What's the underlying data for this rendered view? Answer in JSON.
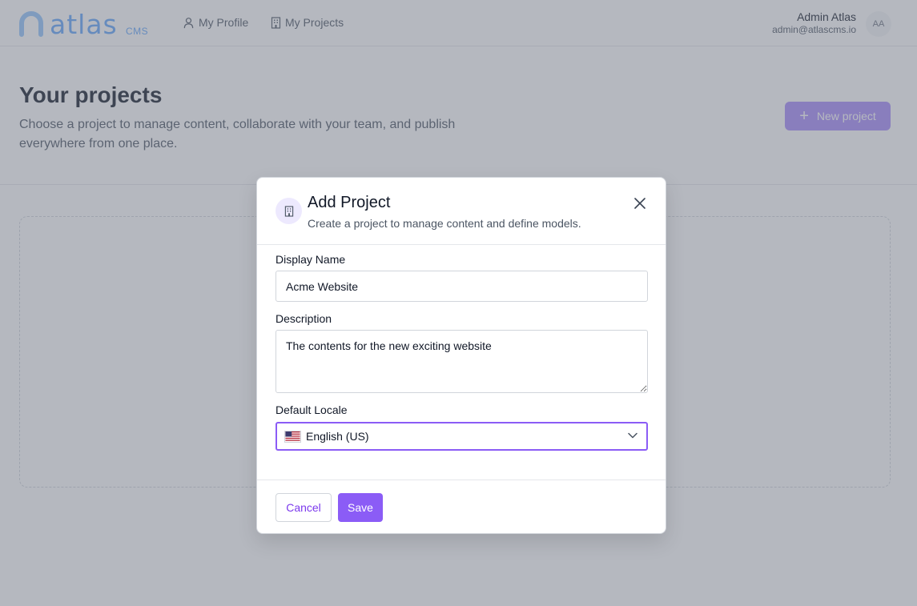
{
  "header": {
    "logo_text": "atlas",
    "logo_sub": "CMS",
    "nav": [
      {
        "label": "My Profile",
        "icon": "user-icon"
      },
      {
        "label": "My Projects",
        "icon": "building-icon"
      }
    ],
    "user": {
      "name": "Admin Atlas",
      "email": "admin@atlascms.io",
      "initials": "AA"
    }
  },
  "page": {
    "title": "Your projects",
    "description": "Choose a project to manage content, collaborate with your team, and publish everywhere from one place.",
    "new_project_label": "New project"
  },
  "modal": {
    "title": "Add Project",
    "subtitle": "Create a project to manage content and define models.",
    "fields": {
      "display_name": {
        "label": "Display Name",
        "value": "Acme Website"
      },
      "description": {
        "label": "Description",
        "value": "The contents for the new exciting website"
      },
      "default_locale": {
        "label": "Default Locale",
        "value": "English (US)",
        "flag": "us-flag-icon"
      }
    },
    "cancel_label": "Cancel",
    "save_label": "Save"
  },
  "colors": {
    "accent": "#8b5cf6",
    "accent_light": "#a78bfa",
    "logo": "#60a5fa",
    "overlay": "rgba(107,114,128,0.5)"
  }
}
